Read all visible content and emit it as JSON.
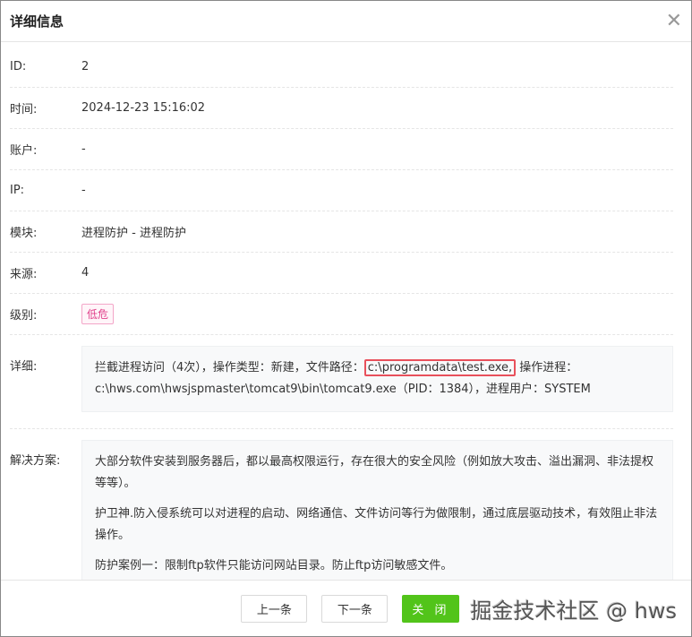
{
  "dialog": {
    "title": "详细信息",
    "close_icon": "close-icon"
  },
  "fields": [
    {
      "label": "ID:",
      "value": "2"
    },
    {
      "label": "时间:",
      "value": "2024-12-23 15:16:02"
    },
    {
      "label": "账户:",
      "value": "-"
    },
    {
      "label": "IP:",
      "value": "-"
    },
    {
      "label": "模块:",
      "value": "进程防护 - 进程防护"
    },
    {
      "label": "来源:",
      "value": "4"
    }
  ],
  "level": {
    "label": "级别:",
    "value": "低危",
    "color": "#e0408a"
  },
  "detail": {
    "label": "详细:",
    "prefix": "拦截进程访问（4次），操作类型：新建，文件路径：",
    "highlight": "c:\\programdata\\test.exe,",
    "suffix": " 操作进程：c:\\hws.com\\hwsjspmaster\\tomcat9\\bin\\tomcat9.exe（PID：1384），进程用户：SYSTEM"
  },
  "solution": {
    "label": "解决方案:",
    "paragraphs": [
      "大部分软件安装到服务器后，都以最高权限运行，存在很大的安全风险（例如放大攻击、溢出漏洞、非法提权等等）。",
      "护卫神.防入侵系统可以对进程的启动、网络通信、文件访问等行为做限制，通过底层驱动技术，有效阻止非法操作。",
      "防护案例一：限制ftp软件只能访问网站目录。防止ftp访问敏感文件。"
    ]
  },
  "footer": {
    "prev": "上一条",
    "next": "下一条",
    "close": "关 闭",
    "watermark": "掘金技术社区 @ hws"
  },
  "colors": {
    "primary": "#52c41a",
    "highlight_border": "#e8505b"
  }
}
